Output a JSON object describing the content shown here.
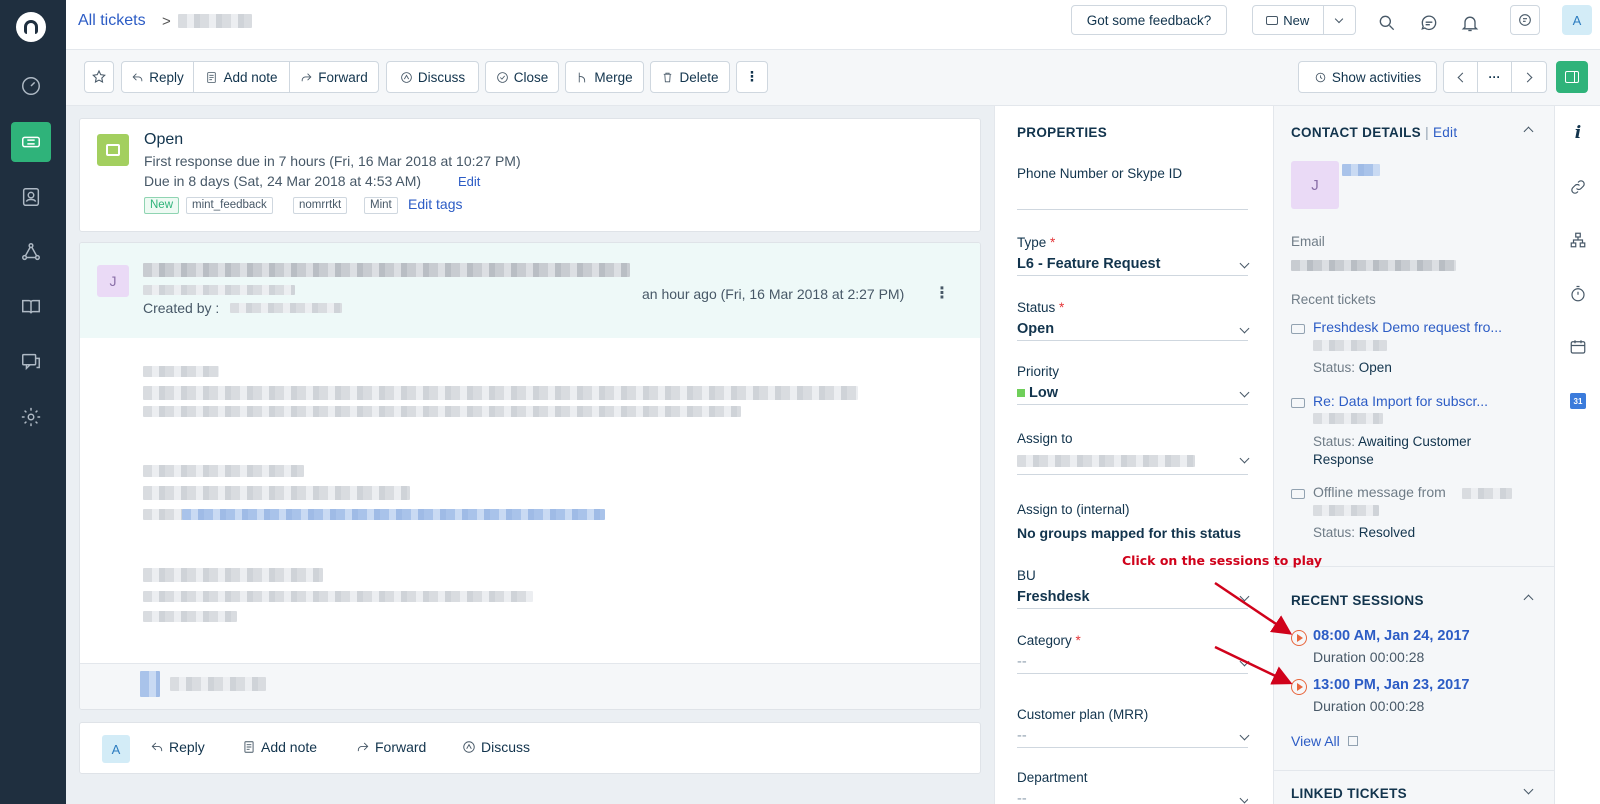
{
  "breadcrumb": {
    "root": "All tickets",
    "separator": ">"
  },
  "topbar": {
    "feedback_label": "Got some feedback?",
    "new_label": "New",
    "avatar_initial": "A"
  },
  "toolbar": {
    "reply": "Reply",
    "add_note": "Add note",
    "forward": "Forward",
    "discuss": "Discuss",
    "close": "Close",
    "merge": "Merge",
    "delete": "Delete",
    "more": "⋮",
    "show_activities": "Show activities",
    "ellipsis": "···"
  },
  "ticket": {
    "status": "Open",
    "first_response": "First response due in 7 hours (Fri, 16 Mar 2018 at 10:27 PM)",
    "due": "Due in 8 days (Sat, 24 Mar 2018 at 4:53 AM)",
    "edit_label": "Edit",
    "tags": [
      "New",
      "mint_feedback",
      "nomrrtkt",
      "Mint"
    ],
    "edit_tags_label": "Edit tags"
  },
  "conversation": {
    "avatar_initial": "J",
    "time": "an hour ago (Fri, 16 Mar 2018 at 2:27 PM)",
    "created_by": "Created by :"
  },
  "reply_bar": {
    "avatar_initial": "A",
    "reply": "Reply",
    "add_note": "Add note",
    "forward": "Forward",
    "discuss": "Discuss"
  },
  "properties": {
    "heading": "PROPERTIES",
    "phone_label": "Phone Number or Skype ID",
    "type_label": "Type",
    "type_value": "L6 - Feature Request",
    "status_label": "Status",
    "status_value": "Open",
    "priority_label": "Priority",
    "priority_value": "Low",
    "priority_color": "#6fcf5a",
    "assign_label": "Assign to",
    "assign_internal_label": "Assign to (internal)",
    "assign_internal_value": "No groups mapped for this status",
    "bu_label": "BU",
    "bu_value": "Freshdesk",
    "category_label": "Category",
    "category_value": "--",
    "plan_label": "Customer plan (MRR)",
    "plan_value": "--",
    "department_label": "Department",
    "department_value": "--",
    "required_mark": "*"
  },
  "contact": {
    "heading": "CONTACT DETAILS",
    "edit_label": "Edit",
    "avatar_initial": "J",
    "email_label": "Email",
    "recent_tickets_label": "Recent tickets",
    "recent_tickets": [
      {
        "title": "Freshdesk Demo request fro...",
        "status_label": "Status:",
        "status": "Open"
      },
      {
        "title": "Re: Data Import for subscr...",
        "status_label": "Status:",
        "status": "Awaiting Customer Response"
      },
      {
        "title": "Offline message from",
        "status_label": "Status:",
        "status": "Resolved"
      }
    ],
    "sessions_heading": "RECENT SESSIONS",
    "sessions": [
      {
        "time": "08:00 AM, Jan 24, 2017",
        "duration": "Duration 00:00:28"
      },
      {
        "time": "13:00 PM, Jan 23, 2017",
        "duration": "Duration 00:00:28"
      }
    ],
    "view_all": "View All",
    "linked_heading": "LINKED TICKETS"
  },
  "annotation": {
    "text": "Click on the sessions to play",
    "color": "#d0021b"
  }
}
